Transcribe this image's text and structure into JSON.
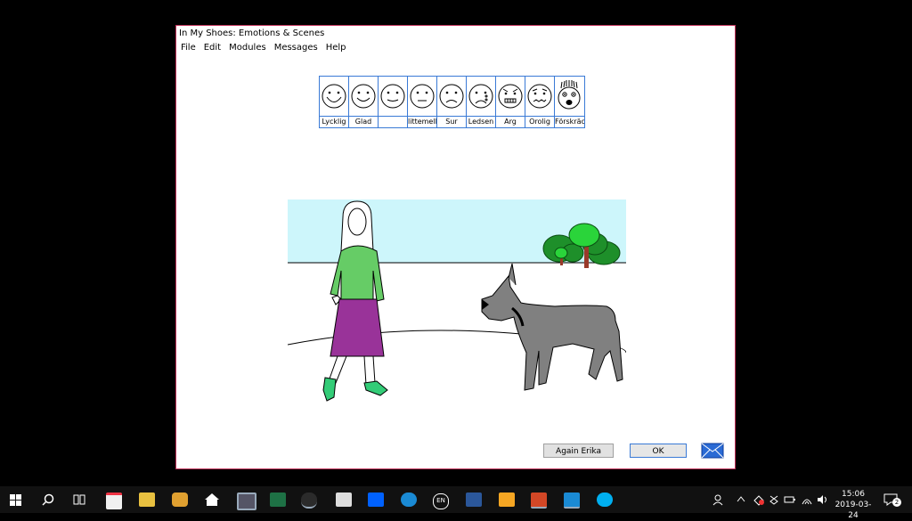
{
  "window": {
    "title": "In My Shoes: Emotions & Scenes",
    "menu": [
      "File",
      "Edit",
      "Modules",
      "Messages",
      "Help"
    ]
  },
  "emotions": [
    {
      "label": "Lycklig",
      "icon": "very-happy-face-icon"
    },
    {
      "label": "Glad",
      "icon": "happy-face-icon"
    },
    {
      "label": "",
      "icon": "content-face-icon"
    },
    {
      "label": "littemella",
      "icon": "neutral-face-icon"
    },
    {
      "label": "Sur",
      "icon": "sulky-face-icon"
    },
    {
      "label": "Ledsen",
      "icon": "sad-crying-face-icon"
    },
    {
      "label": "Arg",
      "icon": "angry-face-icon"
    },
    {
      "label": "Orolig",
      "icon": "worried-face-icon"
    },
    {
      "label": "Förskräck",
      "icon": "scared-face-icon"
    }
  ],
  "buttons": {
    "again": "Again Erika",
    "ok": "OK"
  },
  "taskbar": {
    "lang": "EN",
    "time": "15:06",
    "date": "2019-03-24",
    "notifications": "2"
  }
}
